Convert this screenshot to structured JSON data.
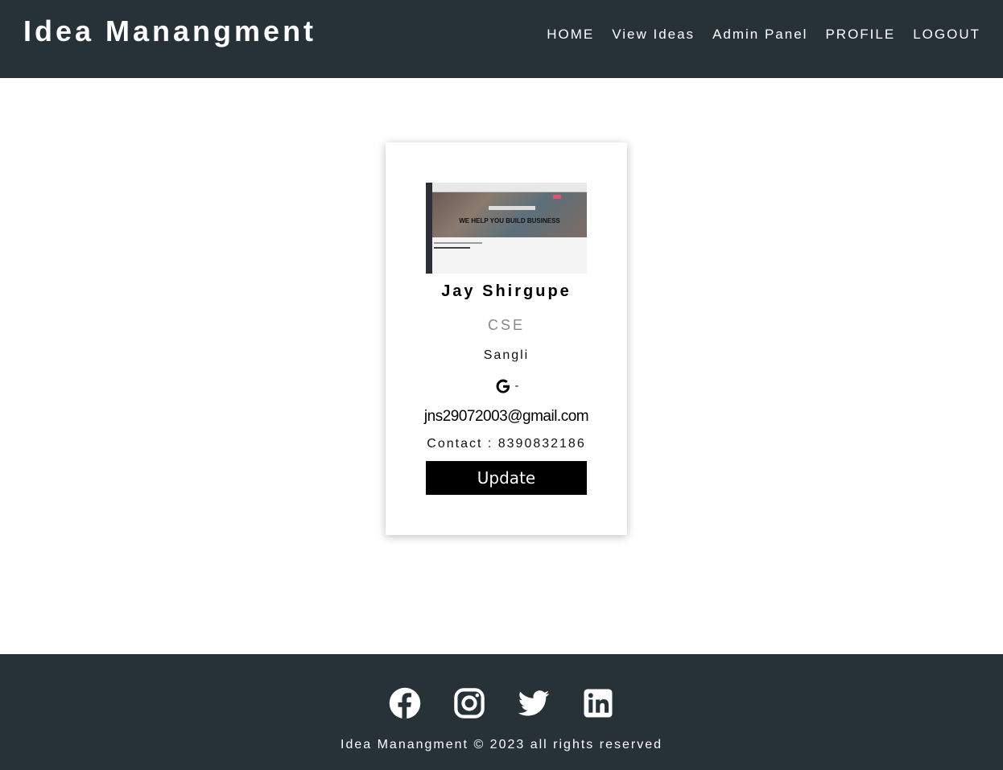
{
  "header": {
    "brand": "Idea Manangment",
    "nav": {
      "home": "HOME",
      "view_ideas": "View Ideas",
      "admin_panel": "Admin Panel",
      "profile": "PROFILE",
      "logout": "LOGOUT"
    }
  },
  "profile": {
    "image_hero_text": "WE HELP YOU BUILD BUSINESS",
    "name": "Jay Shirgupe",
    "department": "CSE",
    "city": "Sangli",
    "email_separator": "-",
    "email": "jns29072003@gmail.com",
    "contact": "Contact : 8390832186",
    "update_label": "Update"
  },
  "footer": {
    "social_icons": [
      "facebook-icon",
      "instagram-icon",
      "twitter-icon",
      "linkedin-icon"
    ],
    "copyright": "Idea Manangment © 2023 all rights reserved"
  },
  "colors": {
    "nav_bg": "#263238",
    "button_bg": "#000000",
    "text_muted": "#888888"
  }
}
